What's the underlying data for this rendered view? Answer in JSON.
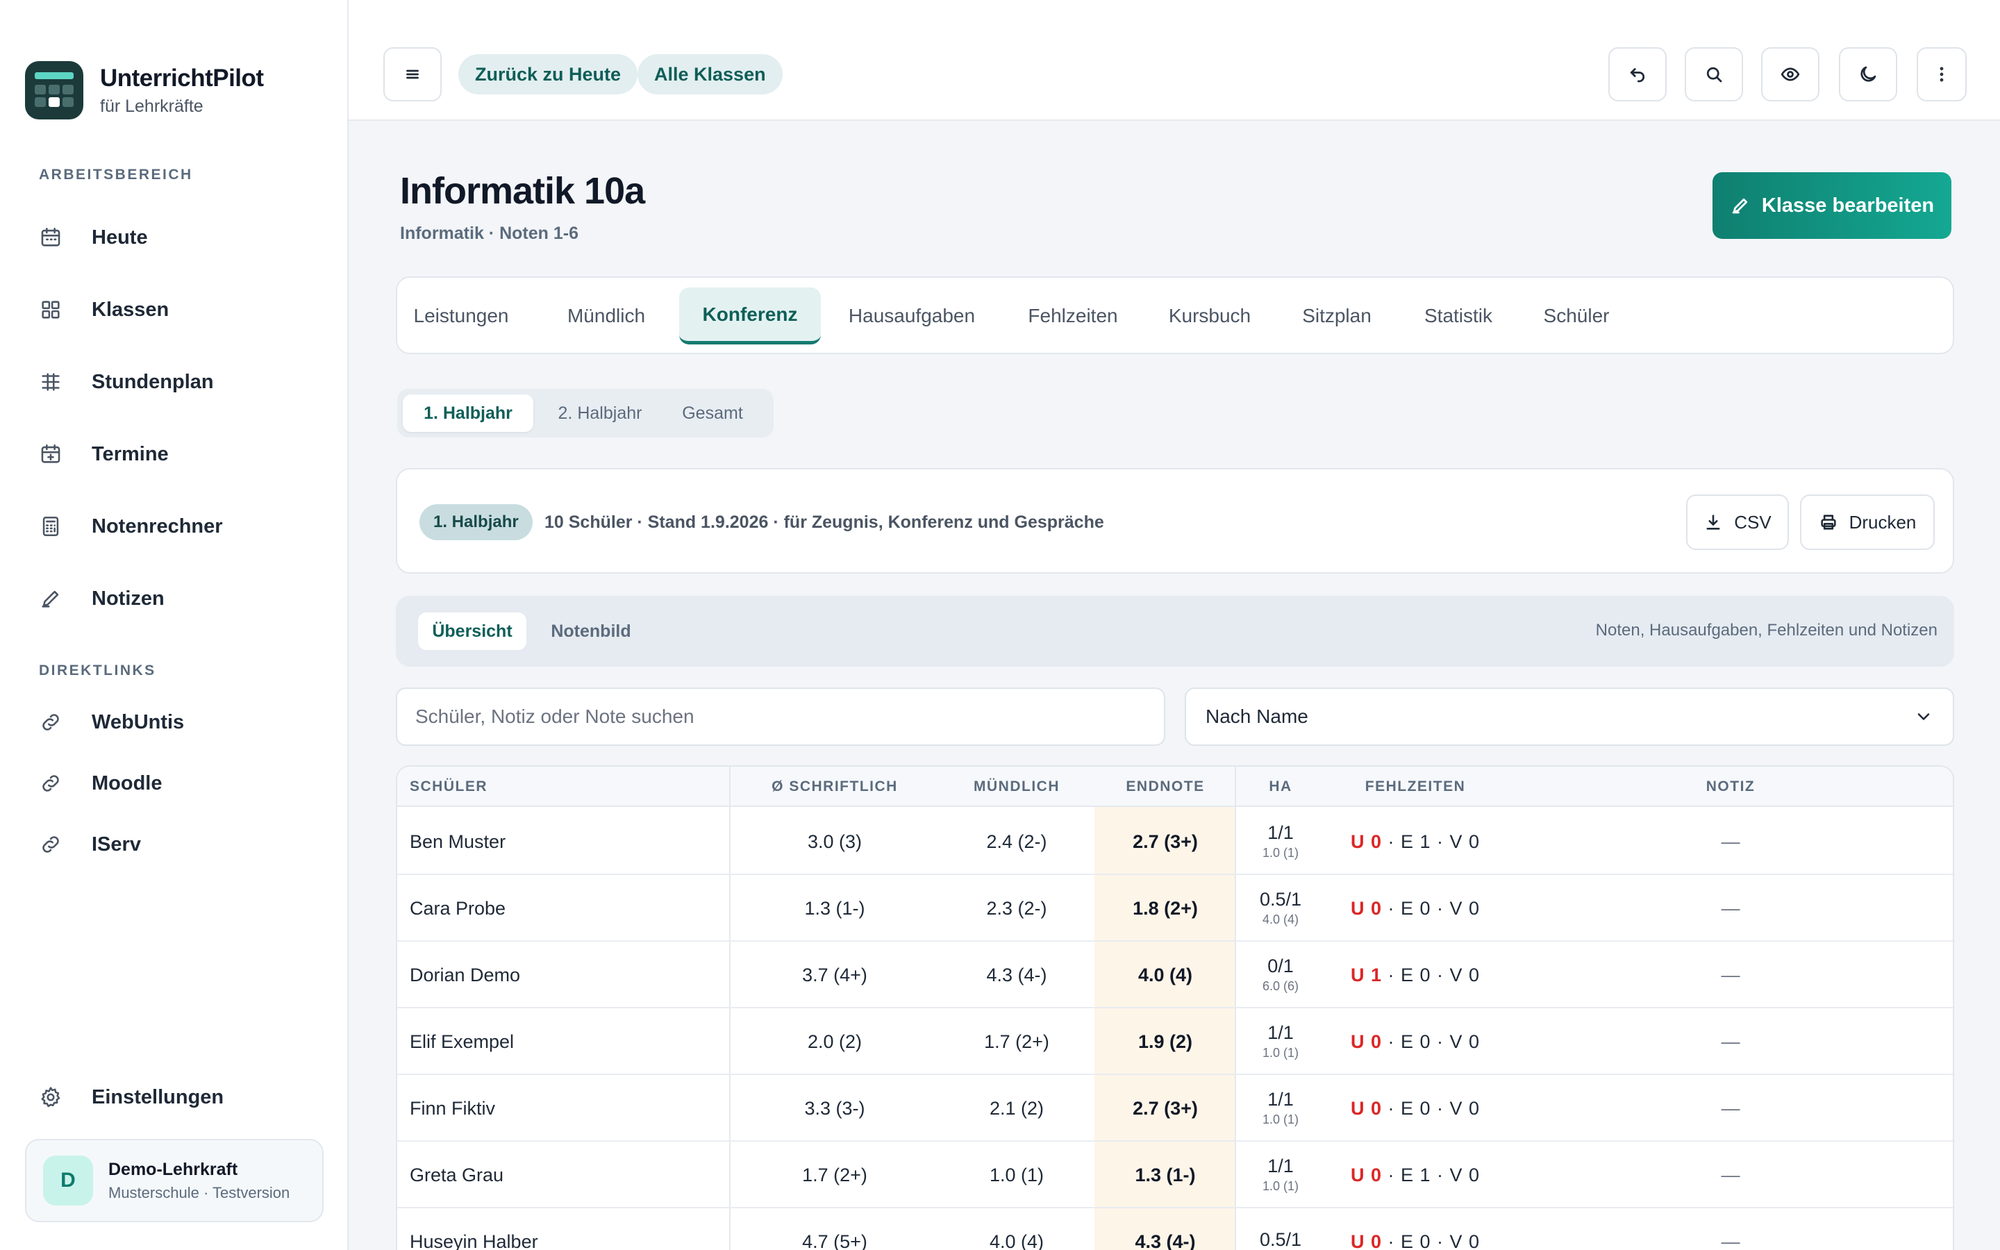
{
  "app": {
    "name": "UnterrichtPilot",
    "subtitle": "für Lehrkräfte"
  },
  "sidebar": {
    "section_work": "ARBEITSBEREICH",
    "work_items": [
      {
        "label": "Heute",
        "icon": "calendar-icon"
      },
      {
        "label": "Klassen",
        "icon": "grid-icon"
      },
      {
        "label": "Stundenplan",
        "icon": "timetable-icon"
      },
      {
        "label": "Termine",
        "icon": "calendar-plus-icon"
      },
      {
        "label": "Notenrechner",
        "icon": "calculator-icon"
      },
      {
        "label": "Notizen",
        "icon": "pen-icon"
      }
    ],
    "section_links": "DIREKTLINKS",
    "link_items": [
      {
        "label": "WebUntis",
        "icon": "link-icon"
      },
      {
        "label": "Moodle",
        "icon": "link-icon"
      },
      {
        "label": "IServ",
        "icon": "link-icon"
      }
    ],
    "settings_label": "Einstellungen",
    "user": {
      "initial": "D",
      "name": "Demo-Lehrkraft",
      "sub": "Musterschule · Testversion"
    }
  },
  "topbar": {
    "back_today": "Zurück zu Heute",
    "all_classes": "Alle Klassen"
  },
  "page": {
    "title": "Informatik 10a",
    "subtitle": "Informatik · Noten 1-6",
    "edit_label": "Klasse bearbeiten"
  },
  "tabs": [
    "Leistungen",
    "Mündlich",
    "Konferenz",
    "Hausaufgaben",
    "Fehlzeiten",
    "Kursbuch",
    "Sitzplan",
    "Statistik",
    "Schüler"
  ],
  "active_tab": "Konferenz",
  "terms": [
    "1. Halbjahr",
    "2. Halbjahr",
    "Gesamt"
  ],
  "info": {
    "badge": "1. Halbjahr",
    "text": "10 Schüler · Stand 1.9.2026 · für Zeugnis, Konferenz und Gespräche",
    "csv": "CSV",
    "print": "Drucken"
  },
  "views": {
    "items": [
      "Übersicht",
      "Notenbild"
    ],
    "hint": "Noten, Hausaufgaben, Fehlzeiten und Notizen"
  },
  "filters": {
    "search_placeholder": "Schüler, Notiz oder Note suchen",
    "sort_value": "Nach Name"
  },
  "table": {
    "headers": [
      "SCHÜLER",
      "Ø SCHRIFTLICH",
      "MÜNDLICH",
      "ENDNOTE",
      "HA",
      "FEHLZEITEN",
      "NOTIZ"
    ],
    "rows": [
      {
        "name": "Ben Muster",
        "written": "3.0 (3)",
        "oral": "2.4 (2-)",
        "final": "2.7 (3+)",
        "ha": "1/1",
        "ha_sub": "1.0 (1)",
        "u": "U 0",
        "rest": "· E 1 · V 0",
        "note": "—"
      },
      {
        "name": "Cara Probe",
        "written": "1.3 (1-)",
        "oral": "2.3 (2-)",
        "final": "1.8 (2+)",
        "ha": "0.5/1",
        "ha_sub": "4.0 (4)",
        "u": "U 0",
        "rest": "· E 0 · V 0",
        "note": "—"
      },
      {
        "name": "Dorian Demo",
        "written": "3.7 (4+)",
        "oral": "4.3 (4-)",
        "final": "4.0 (4)",
        "ha": "0/1",
        "ha_sub": "6.0 (6)",
        "u": "U 1",
        "rest": "· E 0 · V 0",
        "note": "—"
      },
      {
        "name": "Elif Exempel",
        "written": "2.0 (2)",
        "oral": "1.7 (2+)",
        "final": "1.9 (2)",
        "ha": "1/1",
        "ha_sub": "1.0 (1)",
        "u": "U 0",
        "rest": "· E 0 · V 0",
        "note": "—"
      },
      {
        "name": "Finn Fiktiv",
        "written": "3.3 (3-)",
        "oral": "2.1 (2)",
        "final": "2.7 (3+)",
        "ha": "1/1",
        "ha_sub": "1.0 (1)",
        "u": "U 0",
        "rest": "· E 0 · V 0",
        "note": "—"
      },
      {
        "name": "Greta Grau",
        "written": "1.7 (2+)",
        "oral": "1.0 (1)",
        "final": "1.3 (1-)",
        "ha": "1/1",
        "ha_sub": "1.0 (1)",
        "u": "U 0",
        "rest": "· E 1 · V 0",
        "note": "—"
      },
      {
        "name": "Huseyin Halber",
        "written": "4.7 (5+)",
        "oral": "4.0 (4)",
        "final": "4.3 (4-)",
        "ha": "0.5/1",
        "ha_sub": "",
        "u": "U 0",
        "rest": "· E 0 · V 0",
        "note": "—"
      }
    ]
  },
  "colors": {
    "accent": "#137a70",
    "absence_red": "#dc2626",
    "final_bg": "#fdf5e8"
  }
}
